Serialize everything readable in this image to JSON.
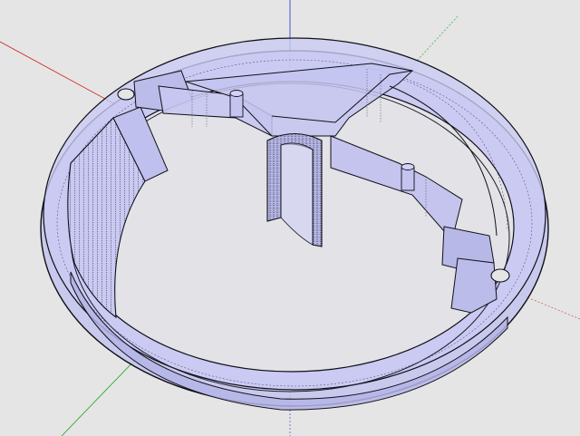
{
  "app": {
    "view": "3d-modeling-viewport",
    "render_style": "x-ray"
  },
  "scene": {
    "object": "annular-ring-part-with-internal-ribs",
    "axes": {
      "red": "#d02020",
      "green": "#18a018",
      "blue": "#2030d0"
    },
    "colors": {
      "background": "#e5e5e5",
      "face_fill": "#c8c8f4",
      "face_fill_dark": "#b2b2e8",
      "edge": "#101018",
      "hidden_edge": "#5a5a7a"
    }
  }
}
